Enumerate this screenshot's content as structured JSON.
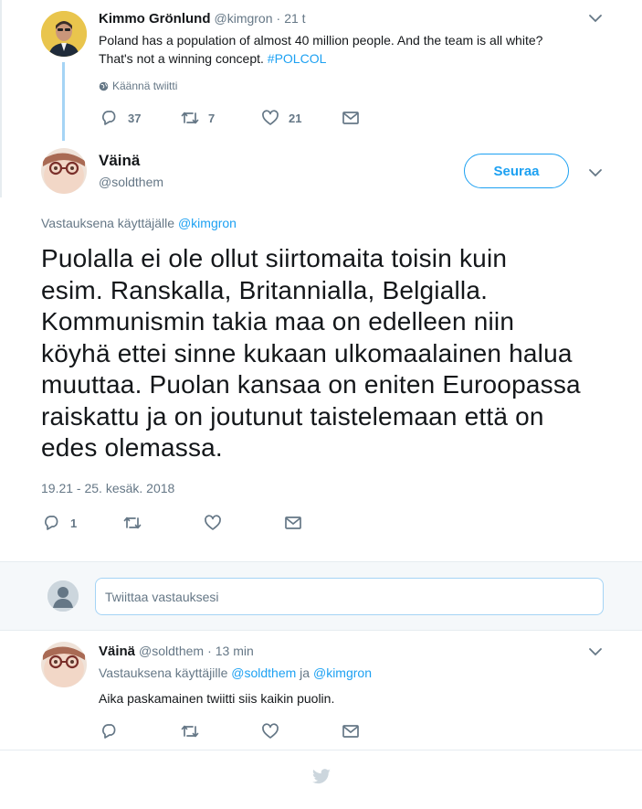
{
  "parent_tweet": {
    "name": "Kimmo Grönlund",
    "handle": "@kimgron",
    "separator": "·",
    "time": "21 t",
    "text_line1": "Poland has a population of almost 40 million people. And the team is all white?",
    "text_line2_plain": "That's not a winning concept. ",
    "hashtag": "#POLCOL",
    "translate_label": "Käännä twiitti",
    "actions": {
      "reply_count": "37",
      "retweet_count": "7",
      "like_count": "21"
    }
  },
  "main_tweet": {
    "name": "Väinä",
    "handle": "@soldthem",
    "follow_label": "Seuraa",
    "reply_to_prefix": "Vastauksena käyttäjälle ",
    "reply_to_handle": "@kimgron",
    "body_lines": [
      "Puolalla ei ole ollut siirtomaita toisin kuin",
      "esim. Ranskalla, Britannialla, Belgialla.",
      "Kommunismin takia maa on edelleen niin",
      "köyhä ettei sinne kukaan ulkomaalainen halua",
      "muuttaa. Puolan kansaa on eniten Euroopassa",
      "raiskattu ja on joutunut taistelemaan että on",
      "edes olemassa."
    ],
    "timestamp": "19.21 - 25. kesäk. 2018",
    "actions": {
      "reply_count": "1"
    }
  },
  "reply_box": {
    "placeholder": "Twiittaa vastauksesi"
  },
  "reply_tweet": {
    "name": "Väinä",
    "handle": "@soldthem",
    "separator": "·",
    "time": "13 min",
    "reply_to_prefix": "Vastauksena käyttäjille ",
    "reply_to_handle1": "@soldthem",
    "reply_to_and": " ja ",
    "reply_to_handle2": "@kimgron",
    "text": "Aika paskamainen twiitti siis kaikin puolin."
  },
  "colors": {
    "accent": "#1da1f2",
    "muted": "#657786",
    "thread_line": "#a5d4f5"
  },
  "icons": [
    "chevron-down-icon",
    "globe-icon",
    "reply-icon",
    "retweet-icon",
    "like-icon",
    "dm-icon",
    "twitter-bird-icon"
  ]
}
